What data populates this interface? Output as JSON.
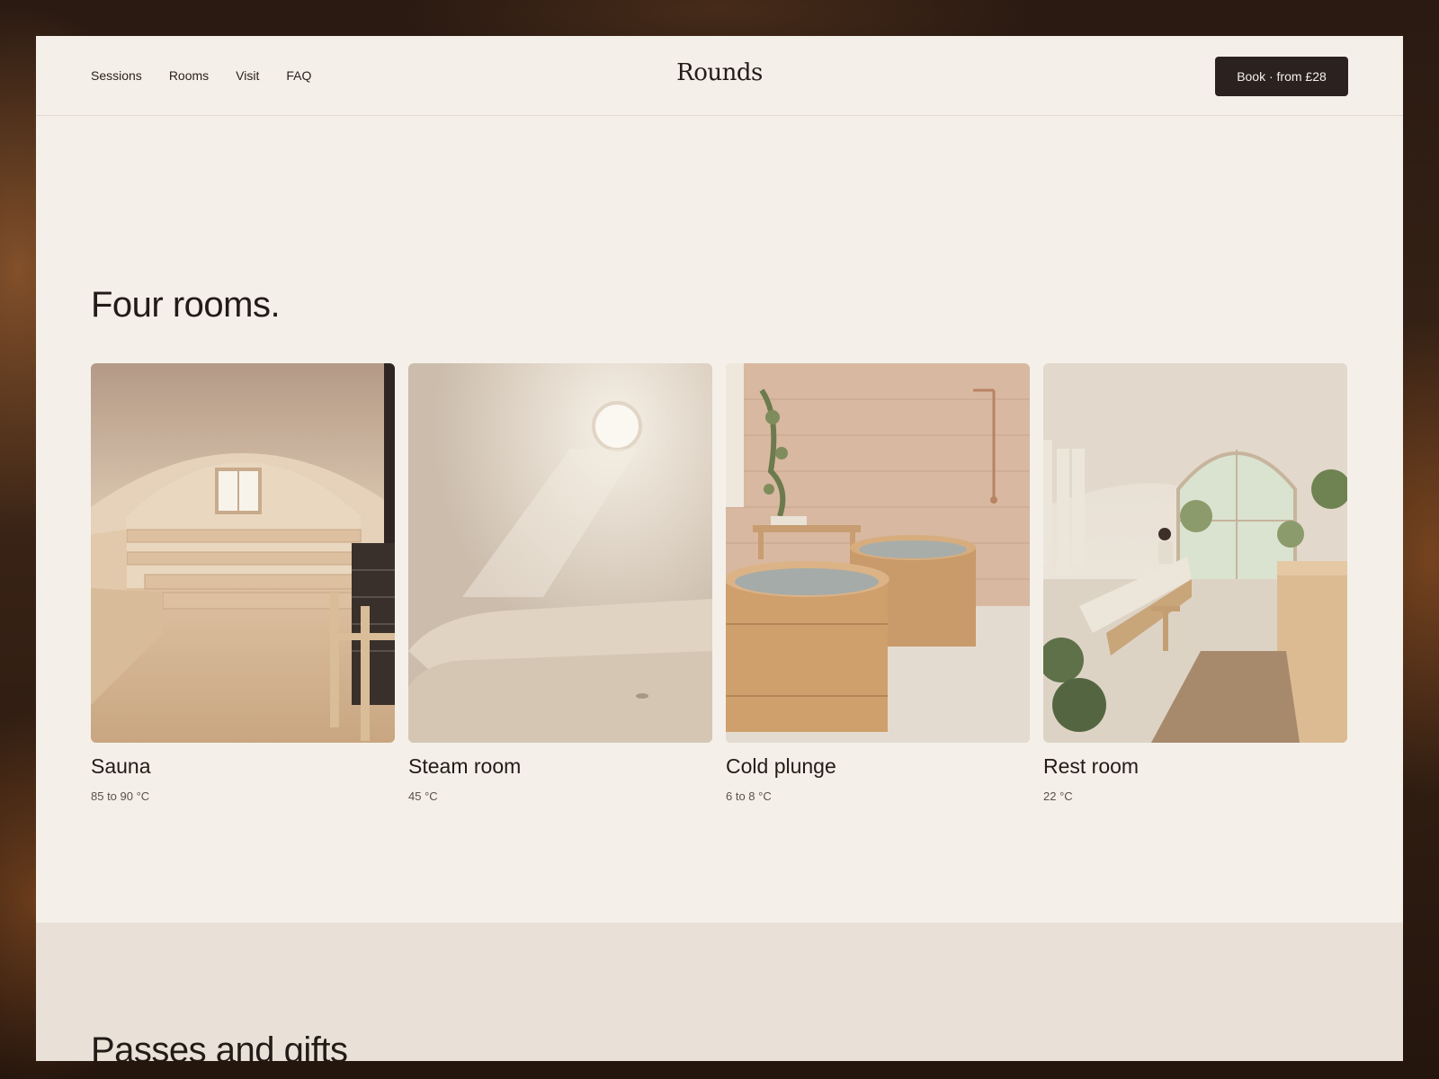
{
  "header": {
    "nav": [
      "Sessions",
      "Rooms",
      "Visit",
      "FAQ"
    ],
    "brand": "Rounds",
    "book_label": "Book · from £28"
  },
  "rooms": {
    "title": "Four rooms.",
    "items": [
      {
        "name": "Sauna",
        "temp": "85 to 90 °C",
        "image": "sauna-photo"
      },
      {
        "name": "Steam room",
        "temp": "45 °C",
        "image": "steam-room-photo"
      },
      {
        "name": "Cold plunge",
        "temp": "6 to 8 °C",
        "image": "cold-plunge-photo"
      },
      {
        "name": "Rest room",
        "temp": "22 °C",
        "image": "rest-room-photo"
      }
    ]
  },
  "passes": {
    "title": "Passes and gifts"
  },
  "colors": {
    "page_bg": "#f4f0e9",
    "section_alt_bg": "#e9e1d7",
    "button_bg": "#2b2220",
    "text": "#231b17"
  }
}
